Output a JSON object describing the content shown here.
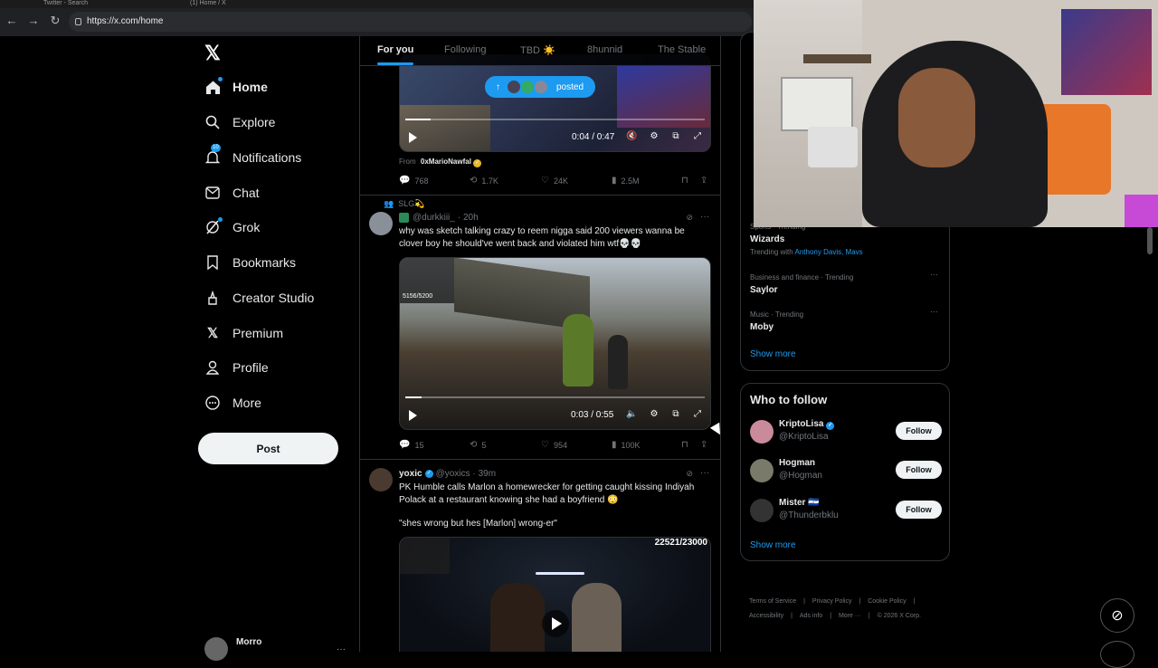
{
  "browser": {
    "tabs": [
      "Twitter - Search",
      "(1) Home / X"
    ],
    "url": "https://x.com/home"
  },
  "sidebar": {
    "items": [
      {
        "label": "Home",
        "icon": "home-icon"
      },
      {
        "label": "Explore",
        "icon": "search-icon"
      },
      {
        "label": "Notifications",
        "icon": "bell-icon",
        "badge": "10"
      },
      {
        "label": "Chat",
        "icon": "mail-icon"
      },
      {
        "label": "Grok",
        "icon": "grok-icon"
      },
      {
        "label": "Bookmarks",
        "icon": "bookmark-icon"
      },
      {
        "label": "Creator Studio",
        "icon": "studio-icon"
      },
      {
        "label": "Premium",
        "icon": "x-icon"
      },
      {
        "label": "Profile",
        "icon": "person-icon"
      },
      {
        "label": "More",
        "icon": "more-circle-icon"
      }
    ],
    "post_label": "Post",
    "user_name": "Morro"
  },
  "feed": {
    "tabs": [
      "For you",
      "Following",
      "TBD ☀️",
      "8hunnid",
      "The Stable"
    ],
    "posted_pill": "posted",
    "tweet1": {
      "time": "0:04 / 0:47",
      "progress": 0.085,
      "from_prefix": "From",
      "from_name": "0xMarioNawfal",
      "replies": "768",
      "reposts": "1.7K",
      "likes": "24K",
      "views": "2.5M"
    },
    "tweet2": {
      "context": "SLG💫",
      "handle": "@durkkiii_",
      "age": "· 20h",
      "text": "why was sketch talking crazy to reem nigga said 200 viewers wanna be clover boy he should've went back and violated him wtf💀💀",
      "overlay": "5156/5200",
      "time": "0:03 / 0:55",
      "progress": 0.055,
      "replies": "15",
      "reposts": "5",
      "likes": "954",
      "views": "100K"
    },
    "tweet3": {
      "name": "yoxic",
      "handle": "@yoxics",
      "age": "· 39m",
      "text": "PK Humble calls Marlon a homewrecker for getting caught kissing Indiyah Polack at a restaurant knowing she had a boyfriend 😳",
      "quote": "\"shes wrong but hes [Marlon] wrong-er\"",
      "overlay": "22521/23000"
    }
  },
  "right": {
    "trends": [
      {
        "meta": "Sports · Trending",
        "name": "Wizards",
        "with_prefix": "Trending with",
        "with": "Anthony Davis, Mavs"
      },
      {
        "meta": "Business and finance · Trending",
        "name": "Saylor"
      },
      {
        "meta": "Music · Trending",
        "name": "Moby"
      }
    ],
    "show_more": "Show more",
    "wtf_title": "Who to follow",
    "follow": [
      {
        "name": "KriptoLisa",
        "handle": "@KriptoLisa",
        "verified": true
      },
      {
        "name": "Hogman",
        "handle": "@Hogman",
        "verified": false
      },
      {
        "name": "Mister 🇸🇻",
        "handle": "@Thunderbklu",
        "verified": false
      }
    ],
    "follow_label": "Follow",
    "footer": [
      "Terms of Service",
      "Privacy Policy",
      "Cookie Policy",
      "Accessibility",
      "Ads info",
      "More ···",
      "© 2026 X Corp."
    ]
  },
  "colors": {
    "accent": "#1d9bf0",
    "bg": "#000000",
    "border": "#2f3336"
  }
}
